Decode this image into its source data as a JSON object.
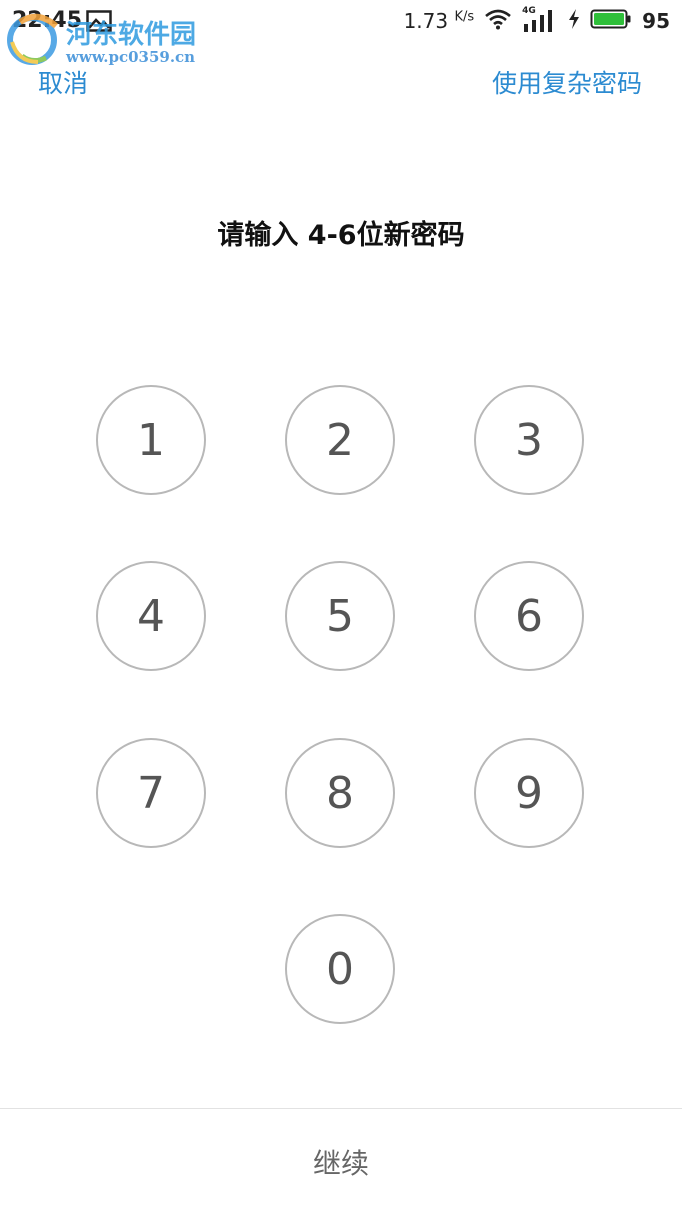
{
  "status_bar": {
    "time": "22:45",
    "speed": "1.73",
    "speed_unit": "K/s",
    "network": "4G",
    "battery": "95",
    "icons": [
      "image-icon",
      "wifi-icon",
      "signal-icon",
      "charging-icon",
      "battery-icon"
    ],
    "battery_color": "#2fbf3a"
  },
  "watermark": {
    "title": "河东软件园",
    "url": "www.pc0359.cn"
  },
  "header": {
    "cancel_label": "取消",
    "complex_password_label": "使用复杂密码"
  },
  "prompt": "请输入 4-6位新密码",
  "keypad": {
    "keys": [
      "1",
      "2",
      "3",
      "4",
      "5",
      "6",
      "7",
      "8",
      "9",
      "0"
    ]
  },
  "footer": {
    "continue_label": "继续"
  },
  "colors": {
    "accent": "#2c8bd1",
    "key_border": "#b8b8b8",
    "key_text": "#555555"
  }
}
